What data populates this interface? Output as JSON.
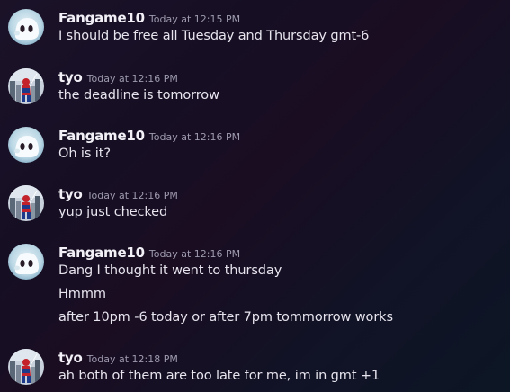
{
  "messages": [
    {
      "author": "Fangame10",
      "avatar_icon": "ghost-avatar-icon",
      "timestamp": "Today at 12:15 PM",
      "lines": [
        "I should be free all Tuesday and Thursday gmt-6"
      ]
    },
    {
      "author": "tyo",
      "avatar_icon": "spiderman-avatar-icon",
      "timestamp": "Today at 12:16 PM",
      "lines": [
        "the deadline is tomorrow"
      ]
    },
    {
      "author": "Fangame10",
      "avatar_icon": "ghost-avatar-icon",
      "timestamp": "Today at 12:16 PM",
      "lines": [
        "Oh is it?"
      ]
    },
    {
      "author": "tyo",
      "avatar_icon": "spiderman-avatar-icon",
      "timestamp": "Today at 12:16 PM",
      "lines": [
        "yup just checked"
      ]
    },
    {
      "author": "Fangame10",
      "avatar_icon": "ghost-avatar-icon",
      "timestamp": "Today at 12:16 PM",
      "lines": [
        "Dang I thought it went to thursday",
        "Hmmm",
        "after 10pm -6 today or after 7pm tommorrow works"
      ]
    },
    {
      "author": "tyo",
      "avatar_icon": "spiderman-avatar-icon",
      "timestamp": "Today at 12:18 PM",
      "lines": [
        "ah both of them are too late for me, im in gmt +1"
      ]
    }
  ],
  "colors": {
    "username": "#f2f0f6",
    "timestamp": "#9e9aae",
    "message_text": "#e7e4ee"
  }
}
